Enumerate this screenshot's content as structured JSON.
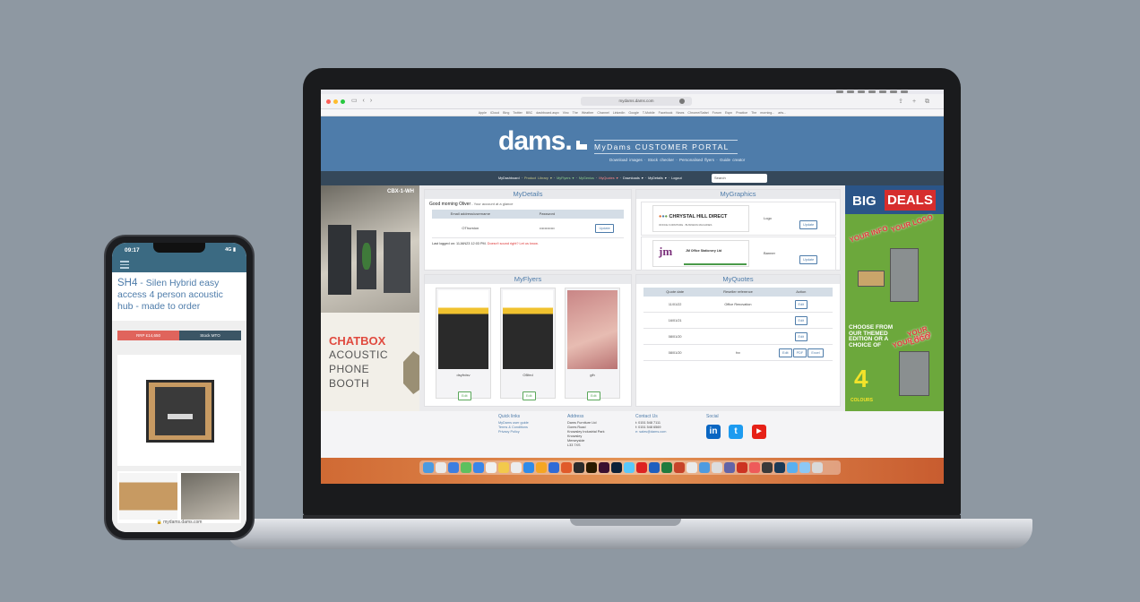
{
  "browser": {
    "url": "mydams.dams.com",
    "favorites": "Apple  iCloud  Bing  Twitter  BBC  dashboard.aspx  Vinc  The Weather Channel  LinkedIn  Google  T-Mobile  Facebook  News  Chrome/Safari Forum  Espn  Practice  The morning... arts..."
  },
  "portal": {
    "logo": "dams.",
    "title_prefix": "My",
    "title_brand": "Dams",
    "title_rest": " CUSTOMER PORTAL",
    "sub_links": "Download images · Stock checker · Personalised flyers · Guide creator"
  },
  "nav": {
    "items": [
      {
        "label": "MyDashboard",
        "tone": "w"
      },
      {
        "label": "Product Library ▾",
        "tone": "y"
      },
      {
        "label": "MyFlyers ▾",
        "tone": "g"
      },
      {
        "label": "MyGenius",
        "tone": "g"
      },
      {
        "label": "MyQuotes ▾",
        "tone": "r"
      },
      {
        "label": "Downloads ▾",
        "tone": "w"
      },
      {
        "label": "MyDetails ▾",
        "tone": "w"
      },
      {
        "label": "Logout",
        "tone": "w"
      }
    ],
    "search_placeholder": "Search"
  },
  "ad_left": {
    "tag": "CBX-1-WH",
    "line1": "CHATBOX",
    "line2": "ACOUSTIC",
    "line3": "PHONE",
    "line4": "BOOTH"
  },
  "ad_right": {
    "big": "BIG",
    "deals": "DEALS",
    "your_info": "YOUR INFO",
    "your_logo": "YOUR LOGO",
    "choose": "CHOOSE FROM OUR THEMED EDITION OR A CHOICE OF",
    "colours": "COLOURS"
  },
  "mydetails": {
    "title": "MyDetails",
    "greeting": "Good morning Oliver",
    "greeting_sub": " - Your account at a glance",
    "col_user": "Email address/username",
    "col_pass": "Password",
    "username": "OThurston",
    "password": "••••••••••••",
    "update": "Update",
    "last_logged": "Last logged on: 11JAN23 12:03 PM. ",
    "warning": "Doesn't sound right? Let us know."
  },
  "mygraphics": {
    "title": "MyGraphics",
    "rows": [
      {
        "logo_text": "CHRYSTAL HILL DIRECT",
        "logo_sub": "OFFICE FURNITURE · BUSINESS MACHINES",
        "kind": "Logo",
        "button": "Update"
      },
      {
        "logo_text": "JM Office Stationery Ltd",
        "logo_sub": "jm",
        "kind": "Banner",
        "button": "Update"
      }
    ]
  },
  "myflyers": {
    "title": "MyFlyers",
    "flyers": [
      {
        "name": "dsyfrdsv",
        "button": "Edit"
      },
      {
        "name": "OBfed",
        "button": "Edit"
      },
      {
        "name": "gfh",
        "button": "Edit"
      }
    ]
  },
  "myquotes": {
    "title": "MyQuotes",
    "col_date": "Quote date",
    "col_ref": "Reseller reference",
    "col_action": "Action",
    "rows": [
      {
        "date": "11/01/22",
        "ref": "Office Renovation",
        "actions": [
          "Edit"
        ]
      },
      {
        "date": "16/01/21",
        "ref": "",
        "actions": [
          "Edit"
        ]
      },
      {
        "date": "08/01/20",
        "ref": "",
        "actions": [
          "Edit"
        ]
      },
      {
        "date": "08/01/20",
        "ref": "fvv",
        "actions": [
          "Edit",
          "PDF",
          "Excel"
        ]
      }
    ]
  },
  "footer": {
    "quick_title": "Quick links",
    "quick_links": [
      "MyDams user guide",
      "Terms & Conditions",
      "Privacy Policy"
    ],
    "address_title": "Address",
    "address": [
      "Dams Furniture Ltd",
      "Gores Road",
      "Knowsley Industrial Park",
      "Knowsley",
      "Merseyside",
      "L33 7XS"
    ],
    "contact_title": "Contact Us",
    "contact": [
      "t: 0151 548 7111",
      "f: 0151 548 6569",
      "e: sales@dams.com"
    ],
    "social_title": "Social",
    "social": [
      {
        "icon": "linkedin-icon",
        "glyph": "in",
        "color": "#0a66c2"
      },
      {
        "icon": "twitter-icon",
        "glyph": "t",
        "color": "#1d9bf0"
      },
      {
        "icon": "youtube-icon",
        "glyph": "▶",
        "color": "#e62117"
      }
    ]
  },
  "phone": {
    "time": "09:17",
    "network": "4G ▮",
    "code": "SH4",
    "title": " - Silen Hybrid easy access 4 person acoustic hub - made to order",
    "tab_rrp": "RRP £14,650",
    "tab_stock": "Stock MTO",
    "url": "🔒 mydams.dams.com"
  },
  "colors": {
    "portal_blue": "#4e7caa",
    "nav_dark": "#35485a",
    "chatbox_red": "#e04a3f",
    "deals_red": "#d62d2d",
    "deals_blue": "#2b5588"
  }
}
